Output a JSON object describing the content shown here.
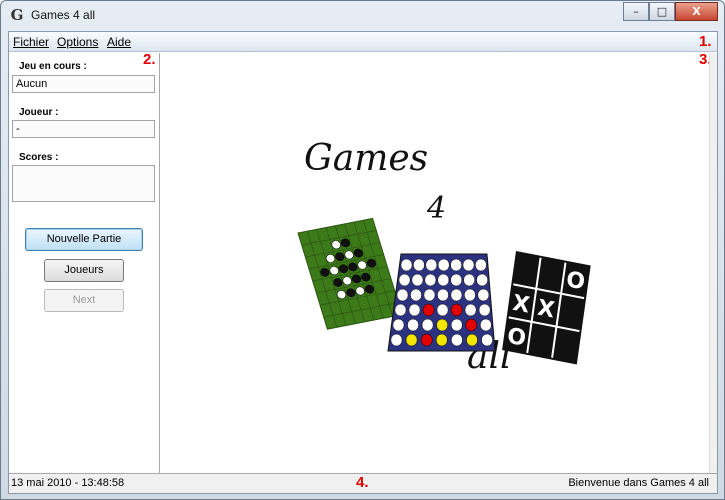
{
  "window": {
    "title": "Games 4 all",
    "icon": "G"
  },
  "window_buttons": {
    "minimize": "–",
    "maximize": "□",
    "close": "X"
  },
  "menu": {
    "items": [
      "Fichier",
      "Options",
      "Aide"
    ]
  },
  "callouts": [
    "1.",
    "2.",
    "3.",
    "4."
  ],
  "sidebar": {
    "current_game_label": "Jeu en cours :",
    "current_game_value": "Aucun",
    "player_label": "Joueur :",
    "player_value": "-",
    "scores_label": "Scores :",
    "scores_value": "",
    "new_game_button": "Nouvelle Partie",
    "players_button": "Joueurs",
    "next_button": "Next"
  },
  "logo": {
    "word1": "Games",
    "word2": "4",
    "word3": "all"
  },
  "tictactoe": [
    "O",
    "X",
    "X",
    "O"
  ],
  "status": {
    "datetime": "13 mai 2010 - 13:48:58",
    "message": "Bienvenue dans Games 4 all"
  },
  "colors": {
    "othello_board": "#3d7a1a",
    "connect4_board": "#2b3280",
    "tictactoe_board": "#111111",
    "red_piece": "#e00000",
    "yellow_piece": "#f2e600",
    "callout": "#e00000"
  }
}
